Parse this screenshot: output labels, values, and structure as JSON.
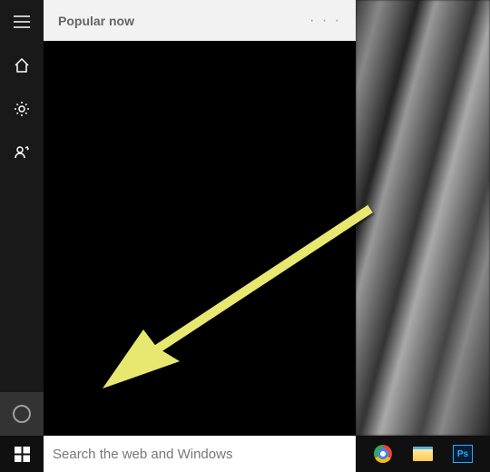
{
  "header": {
    "title": "Popular now",
    "more": "· · ·"
  },
  "search": {
    "placeholder": "Search the web and Windows",
    "value": ""
  },
  "taskbar": {
    "ps_label": "Ps"
  },
  "colors": {
    "arrow": "#E8E870",
    "panel_header_bg": "#f2f2f2",
    "sidebar_bg": "#191919"
  }
}
